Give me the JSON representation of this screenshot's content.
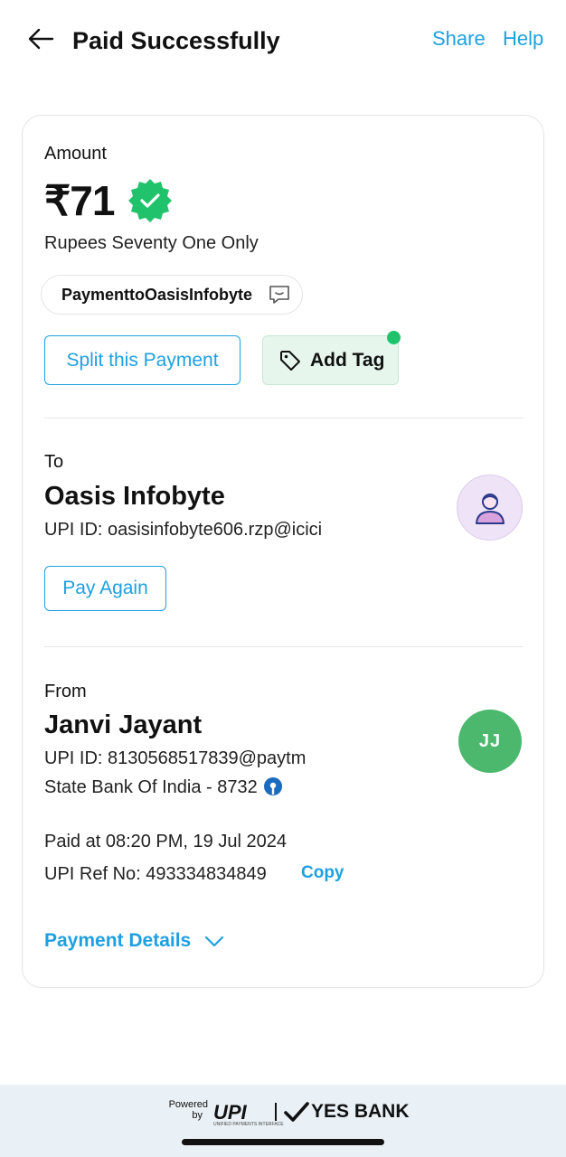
{
  "header": {
    "title": "Paid Successfully",
    "share_label": "Share",
    "help_label": "Help"
  },
  "amount_section": {
    "label": "Amount",
    "amount": "₹71",
    "in_words": "Rupees Seventy One Only",
    "note": "PaymenttoOasisInfobyte",
    "split_label": "Split this Payment",
    "add_tag_label": "Add Tag"
  },
  "to_section": {
    "label": "To",
    "name": "Oasis Infobyte",
    "upi_id": "UPI ID: oasisinfobyte606.rzp@icici",
    "pay_again_label": "Pay Again"
  },
  "from_section": {
    "label": "From",
    "name": "Janvi Jayant",
    "initials": "JJ",
    "upi_id": "UPI ID: 8130568517839@paytm",
    "bank": "State Bank Of India - 8732",
    "paid_at": "Paid at 08:20 PM, 19 Jul 2024",
    "ref_no": "UPI Ref No: 493334834849",
    "copy_label": "Copy"
  },
  "payment_details_label": "Payment Details",
  "footer": {
    "powered_line1": "Powered",
    "powered_line2": "by",
    "upi_logo": "UPI",
    "upi_tagline": "UNIFIED PAYMENTS INTERFACE",
    "bank_logo": "YES BANK"
  },
  "colors": {
    "accent": "#1ea0e0",
    "success": "#20c36b",
    "avatar_green": "#4cb86e",
    "tag_bg": "#e6f6ec"
  },
  "icons": {
    "back": "arrow-left-icon",
    "verified": "verified-badge-icon",
    "note": "chat-bubble-icon",
    "tag": "tag-icon",
    "merchant": "person-icon",
    "bank": "sbi-logo-icon",
    "expand": "chevron-down-icon"
  }
}
